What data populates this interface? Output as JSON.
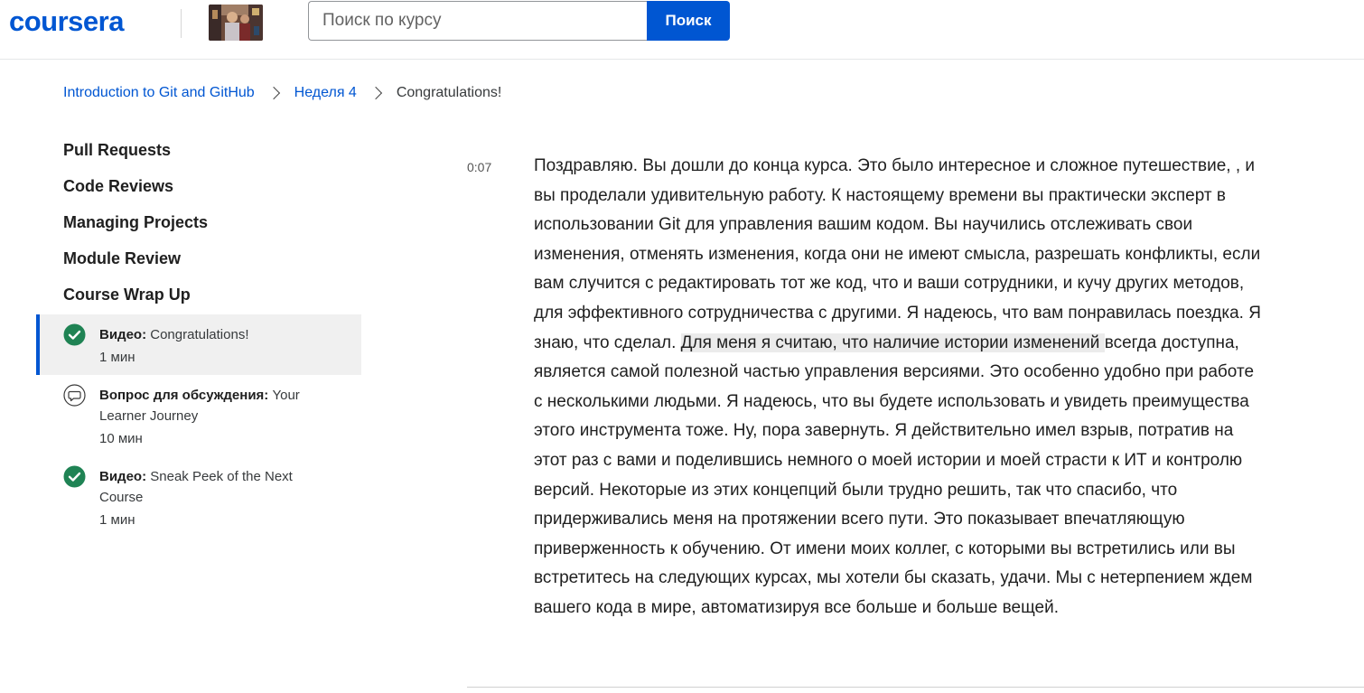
{
  "header": {
    "logo": "coursera",
    "search_placeholder": "Поиск по курсу",
    "search_button": "Поиск"
  },
  "breadcrumb": {
    "course": "Introduction to Git and GitHub",
    "week": "Неделя 4",
    "current": "Congratulations!"
  },
  "sidebar": {
    "modules": [
      "Pull Requests",
      "Code Reviews",
      "Managing Projects",
      "Module Review",
      "Course Wrap Up"
    ],
    "lessons": [
      {
        "type": "Видео:",
        "title": "Congratulations!",
        "duration": "1 мин",
        "icon": "check-circle-icon",
        "active": true
      },
      {
        "type": "Вопрос для обсуждения:",
        "title": "Your Learner Journey",
        "duration": "10 мин",
        "icon": "discussion-icon",
        "active": false
      },
      {
        "type": "Видео:",
        "title": "Sneak Peek of the Next Course",
        "duration": "1 мин",
        "icon": "check-circle-icon",
        "active": false
      }
    ]
  },
  "transcript": {
    "timestamp": "0:07",
    "text_before": "Поздравляю. Вы дошли до конца курса. Это было интересное и сложное путешествие, , и вы проделали удивительную работу. К настоящему времени вы практически эксперт в использовании Git для управления вашим кодом. Вы научились отслеживать свои изменения, отменять изменения, когда они не имеют смысла, разрешать конфликты, если вам случится с редактировать тот же код, что и ваши сотрудники, и кучу других методов, для эффективного сотрудничества с другими. Я надеюсь, что вам понравилась поездка. Я знаю, что сделал. ",
    "text_highlight": "Для меня я считаю, что наличие истории изменений ",
    "text_after": "всегда доступна, является самой полезной частью управления версиями. Это особенно удобно при работе с несколькими людьми. Я надеюсь, что вы будете использовать и увидеть преимущества этого инструмента тоже. Ну, пора завернуть. Я действительно имел взрыв, потратив на этот раз с вами и поделившись немного о моей истории и моей страсти к ИТ и контролю версий. Некоторые из этих концепций были трудно решить, так что спасибо, что придерживались меня на протяжении всего пути. Это показывает впечатляющую приверженность к обучению. От имени моих коллег, с которыми вы встретились или вы встретитесь на следующих курсах, мы хотели бы сказать, удачи. Мы с нетерпением ждем вашего кода в мире, автоматизируя все больше и больше вещей."
  },
  "colors": {
    "brand": "#0056d2",
    "complete": "#1f8354",
    "active_bg": "#f0f0f0",
    "highlight_bg": "#ebebeb"
  }
}
